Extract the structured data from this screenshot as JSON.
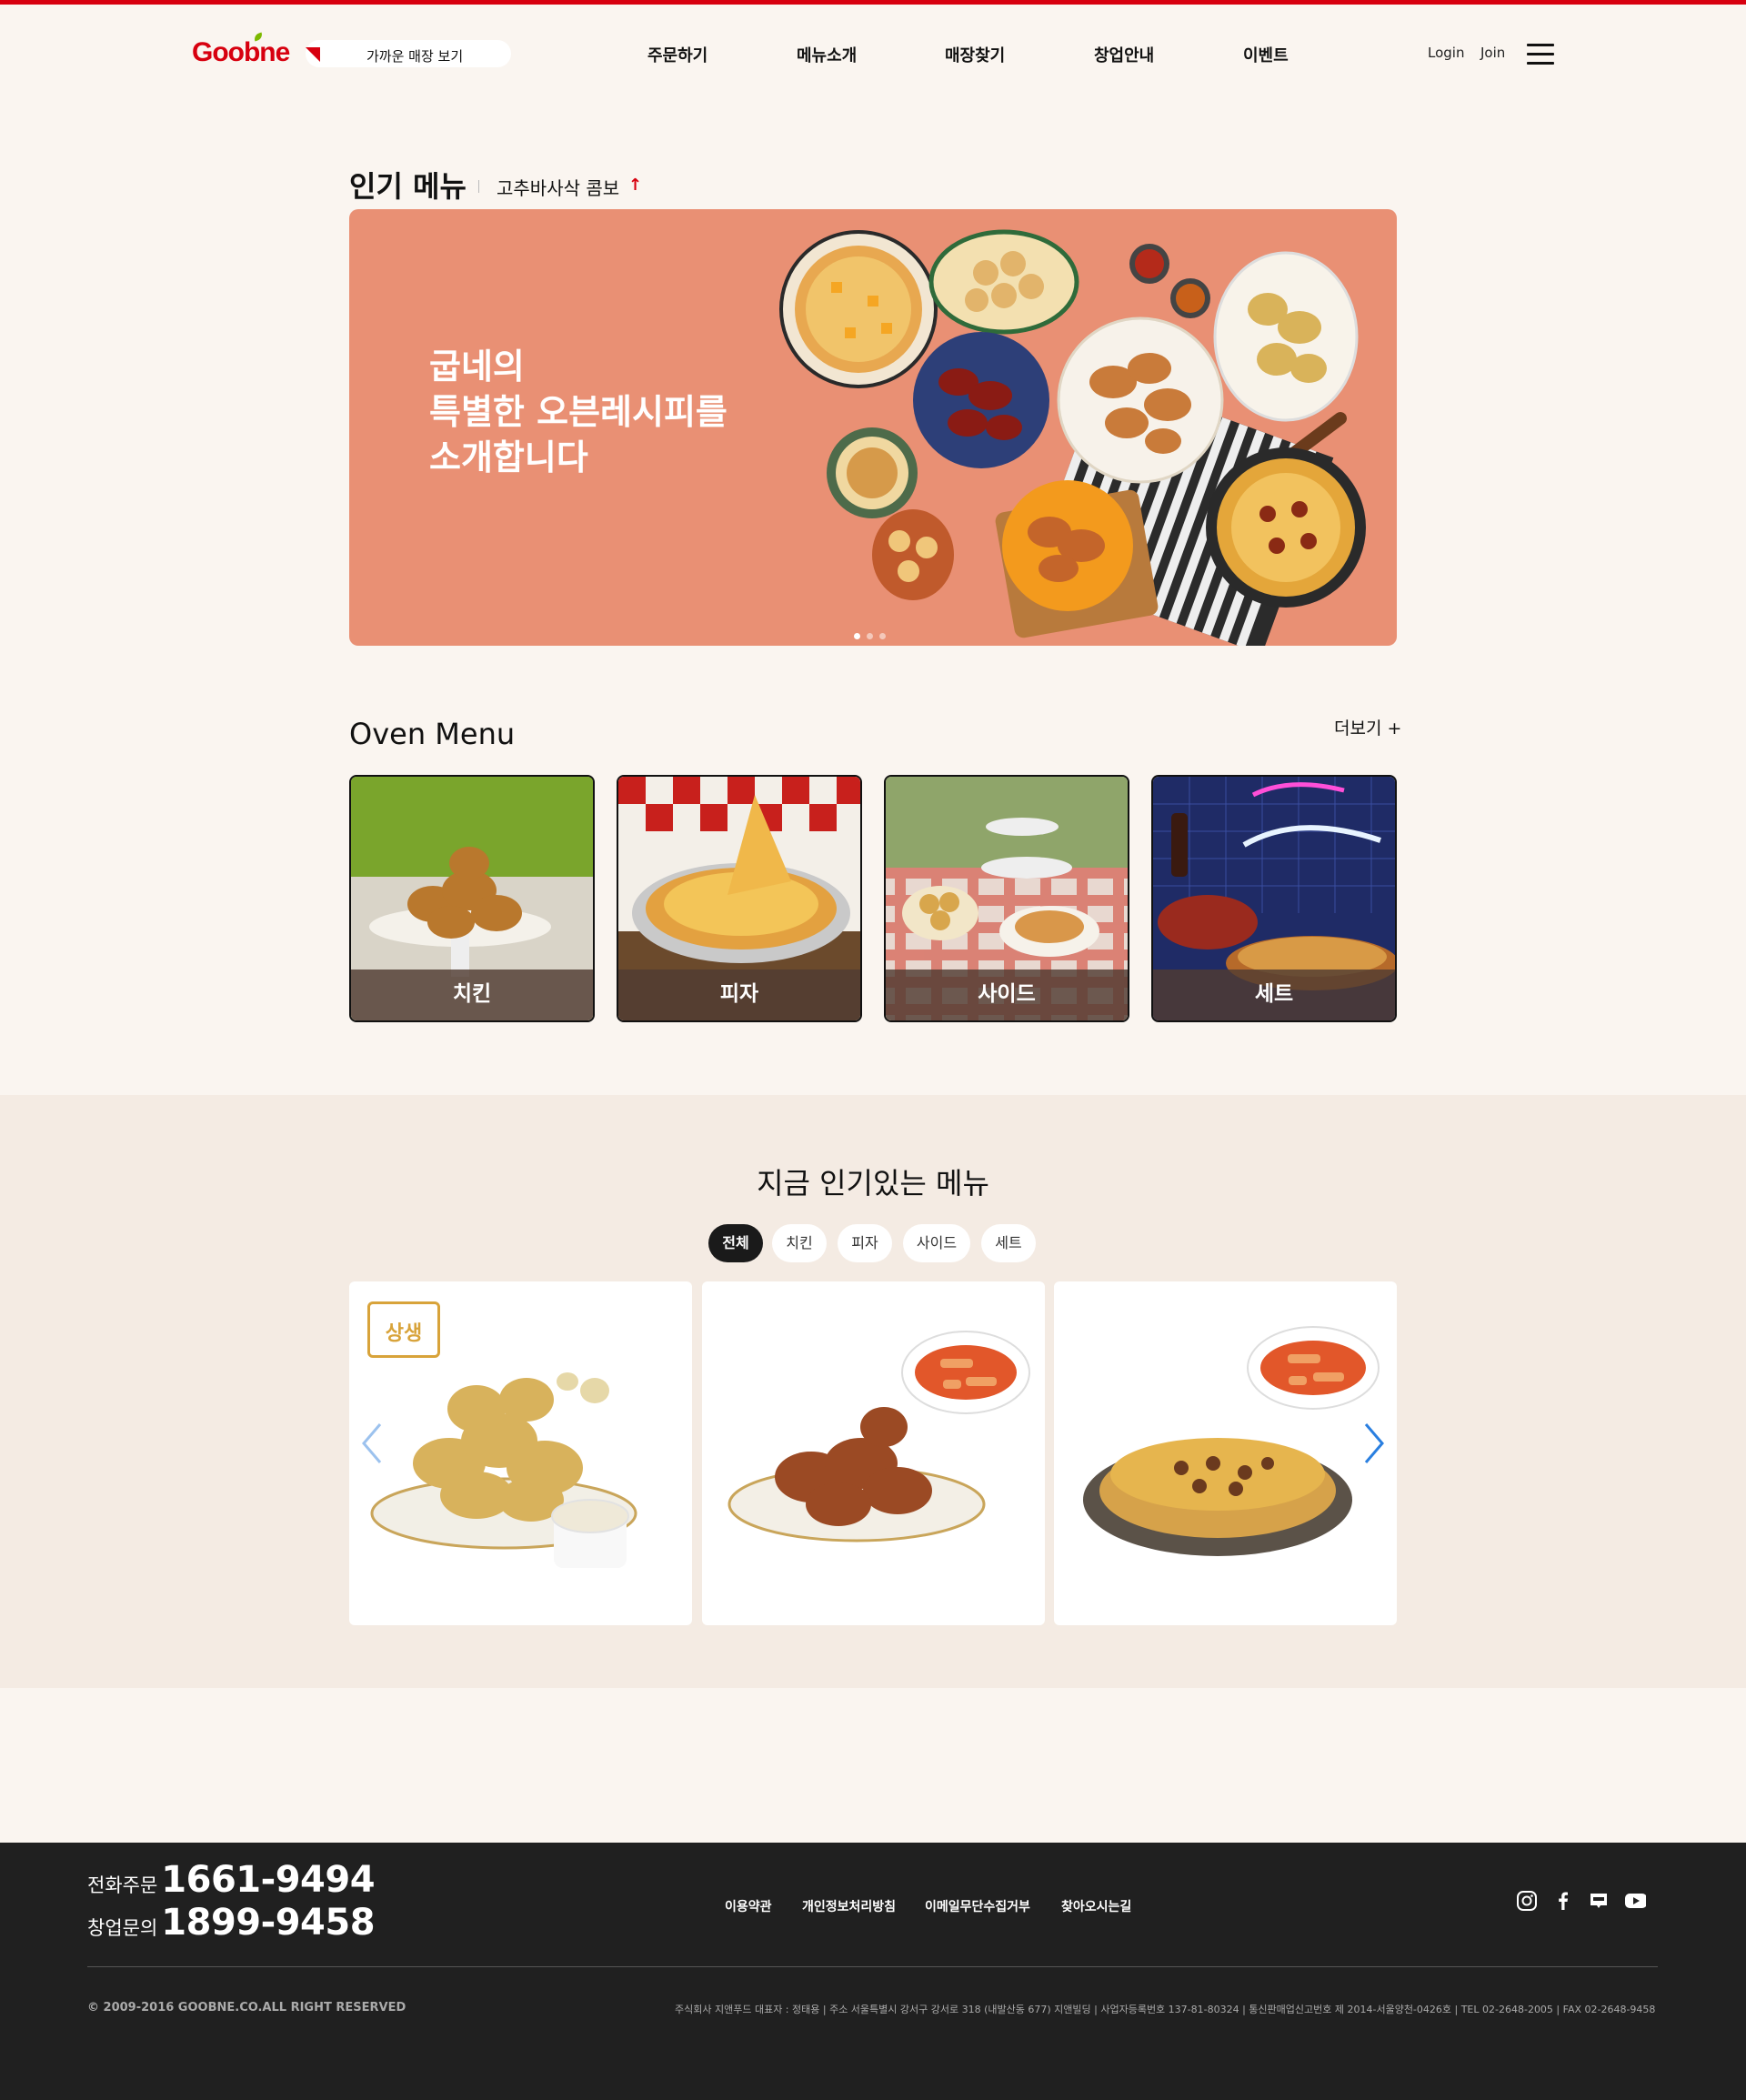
{
  "header": {
    "logo": "Goobne",
    "locator_label": "가까운 매장 보기",
    "nav": [
      "주문하기",
      "메뉴소개",
      "매장찾기",
      "창업안내",
      "이벤트"
    ],
    "login": "Login",
    "join": "Join"
  },
  "popular": {
    "title": "인기 메뉴",
    "subtitle": "고추바사삭 콤보",
    "subtitle_arrow": "↑",
    "banner_lines": [
      "굽네의",
      "특별한 오븐레시피를",
      "소개합니다"
    ],
    "slide_count": 3,
    "active_slide": 1
  },
  "oven": {
    "title": "Oven Menu",
    "more": "더보기 +",
    "categories": [
      "치킨",
      "피자",
      "사이드",
      "세트"
    ]
  },
  "now": {
    "title": "지금 인기있는 메뉴",
    "filters": [
      "전체",
      "치킨",
      "피자",
      "사이드",
      "세트"
    ],
    "active_filter": "전체",
    "badge": "상생"
  },
  "footer": {
    "order_label": "전화주문",
    "order_tel": "1661-9494",
    "franchise_label": "창업문의",
    "franchise_tel": "1899-9458",
    "links": [
      "이용약관",
      "개인정보처리방침",
      "이메일무단수집거부",
      "찾아오시는길"
    ],
    "copyright": "© 2009-2016 GOOBNE.CO.ALL RIGHT RESERVED",
    "corp_info": "주식회사 지앤푸드 대표자 : 정태용  |  주소 서울특별시 강서구 강서로 318 (내발산동 677) 지앤빌딩  |  사업자등록번호 137-81-80324  |  통신판매업신고번호 제 2014-서울양천-0426호  |  TEL 02-2648-2005  |  FAX 02-2648-9458"
  },
  "colors": {
    "brand_red": "#d7000f",
    "page_bg": "#faf5f0",
    "section_bg": "#f4ebe3",
    "footer_bg": "#202020",
    "banner_bg": "#e99074"
  }
}
